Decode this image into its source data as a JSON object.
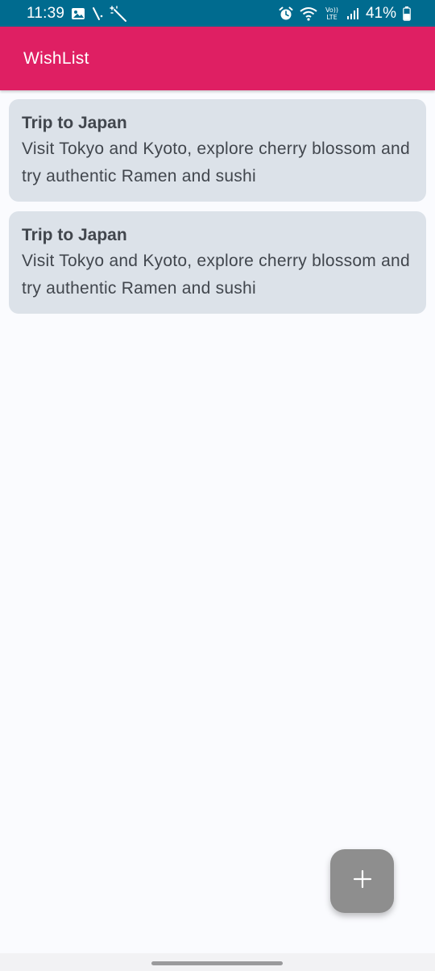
{
  "status_bar": {
    "time": "11:39",
    "battery_percent": "41%",
    "volte_label": "Vo)) LTE",
    "left_icons": [
      "image-icon",
      "slash-icon",
      "magic-wand-icon"
    ],
    "right_icons": [
      "alarm-icon",
      "wifi-icon",
      "volte-icon",
      "signal-icon",
      "battery-icon"
    ]
  },
  "app_bar": {
    "title": "WishList",
    "color": "#df1f63"
  },
  "wishes": [
    {
      "title": "Trip to Japan",
      "description": "Visit Tokyo and Kyoto, explore cherry blossom and try authentic Ramen and sushi"
    },
    {
      "title": "Trip to Japan",
      "description": "Visit Tokyo and Kyoto, explore cherry blossom and try authentic Ramen and sushi"
    }
  ],
  "fab": {
    "icon": "plus-icon",
    "color": "#8e8e8e"
  }
}
